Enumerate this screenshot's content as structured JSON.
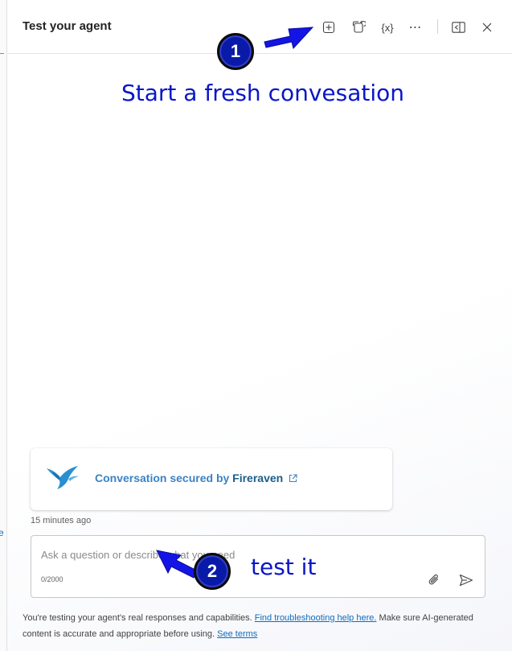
{
  "panel": {
    "title": "Test your agent",
    "header_icons": [
      "new-conversation-icon",
      "refresh-icon",
      "variables-icon",
      "more-icon",
      "dock-icon",
      "close-icon"
    ],
    "variables_glyph": "{x}",
    "more_glyph": "⋯"
  },
  "annotations": {
    "badge1": "1",
    "badge2": "2",
    "note1": "Start a fresh convesation",
    "note2": "test it",
    "color": "#0a16c8"
  },
  "security": {
    "prefix": "Conversation secured by",
    "brand": "Fireraven"
  },
  "timestamp": "15 minutes ago",
  "composer": {
    "placeholder": "Ask a question or describe what you need",
    "value": "",
    "counter": "0/2000"
  },
  "disclaimer": {
    "part1": "You're testing your agent's real responses and capabilities.",
    "link1": "Find troubleshooting help here.",
    "part2": "Make sure AI-generated content is accurate and appropriate before using.",
    "link2": "See terms"
  },
  "page_edge": {
    "letter": "e"
  }
}
